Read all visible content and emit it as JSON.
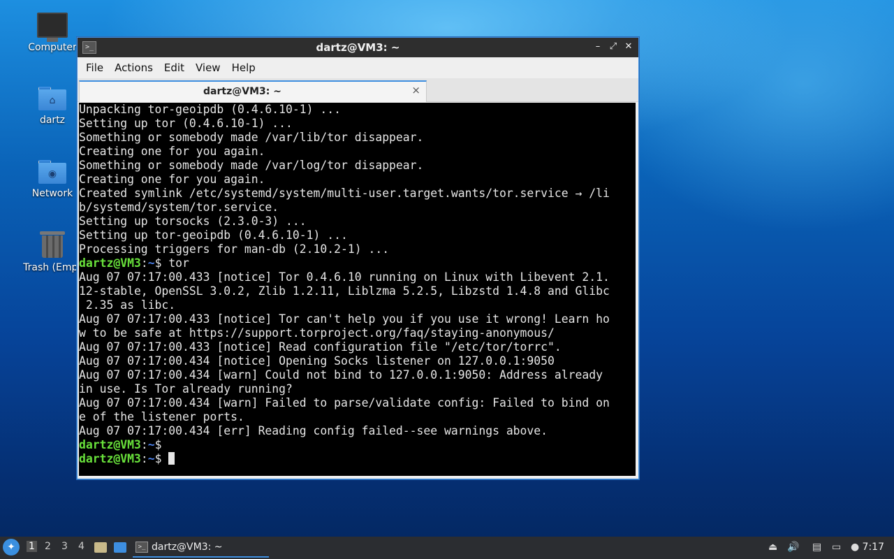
{
  "desktop": {
    "icons": [
      {
        "label": "Computer",
        "icon": "computer-icon"
      },
      {
        "label": "dartz",
        "icon": "home-folder-icon"
      },
      {
        "label": "Network",
        "icon": "network-folder-icon"
      },
      {
        "label": "Trash (Empt",
        "icon": "trash-icon"
      }
    ]
  },
  "window": {
    "title": "dartz@VM3: ~",
    "menu": [
      "File",
      "Actions",
      "Edit",
      "View",
      "Help"
    ],
    "tab_label": "dartz@VM3: ~",
    "tab_close": "×",
    "controls": {
      "minimize": "–",
      "maximize": "⤢",
      "close": "✕"
    }
  },
  "terminal": {
    "lines": [
      "Unpacking tor-geoipdb (0.4.6.10-1) ...",
      "Setting up tor (0.4.6.10-1) ...",
      "Something or somebody made /var/lib/tor disappear.",
      "Creating one for you again.",
      "Something or somebody made /var/log/tor disappear.",
      "Creating one for you again.",
      "Created symlink /etc/systemd/system/multi-user.target.wants/tor.service → /li",
      "b/systemd/system/tor.service.",
      "Setting up torsocks (2.3.0-3) ...",
      "Setting up tor-geoipdb (0.4.6.10-1) ...",
      "Processing triggers for man-db (2.10.2-1) ..."
    ],
    "prompt_user": "dartz@VM3",
    "prompt_sep": ":",
    "prompt_path": "~",
    "prompt_end": "$ ",
    "command": "tor",
    "output": [
      "Aug 07 07:17:00.433 [notice] Tor 0.4.6.10 running on Linux with Libevent 2.1.",
      "12-stable, OpenSSL 3.0.2, Zlib 1.2.11, Liblzma 5.2.5, Libzstd 1.4.8 and Glibc",
      " 2.35 as libc.",
      "Aug 07 07:17:00.433 [notice] Tor can't help you if you use it wrong! Learn ho",
      "w to be safe at https://support.torproject.org/faq/staying-anonymous/",
      "Aug 07 07:17:00.433 [notice] Read configuration file \"/etc/tor/torrc\".",
      "Aug 07 07:17:00.434 [notice] Opening Socks listener on 127.0.0.1:9050",
      "Aug 07 07:17:00.434 [warn] Could not bind to 127.0.0.1:9050: Address already",
      "in use. Is Tor already running?",
      "Aug 07 07:17:00.434 [warn] Failed to parse/validate config: Failed to bind on",
      "e of the listener ports.",
      "Aug 07 07:17:00.434 [err] Reading config failed--see warnings above."
    ]
  },
  "taskbar": {
    "workspaces": [
      "1",
      "2",
      "3",
      "4"
    ],
    "active_workspace": "1",
    "task_label": "dartz@VM3: ~",
    "clock": "7:17"
  }
}
